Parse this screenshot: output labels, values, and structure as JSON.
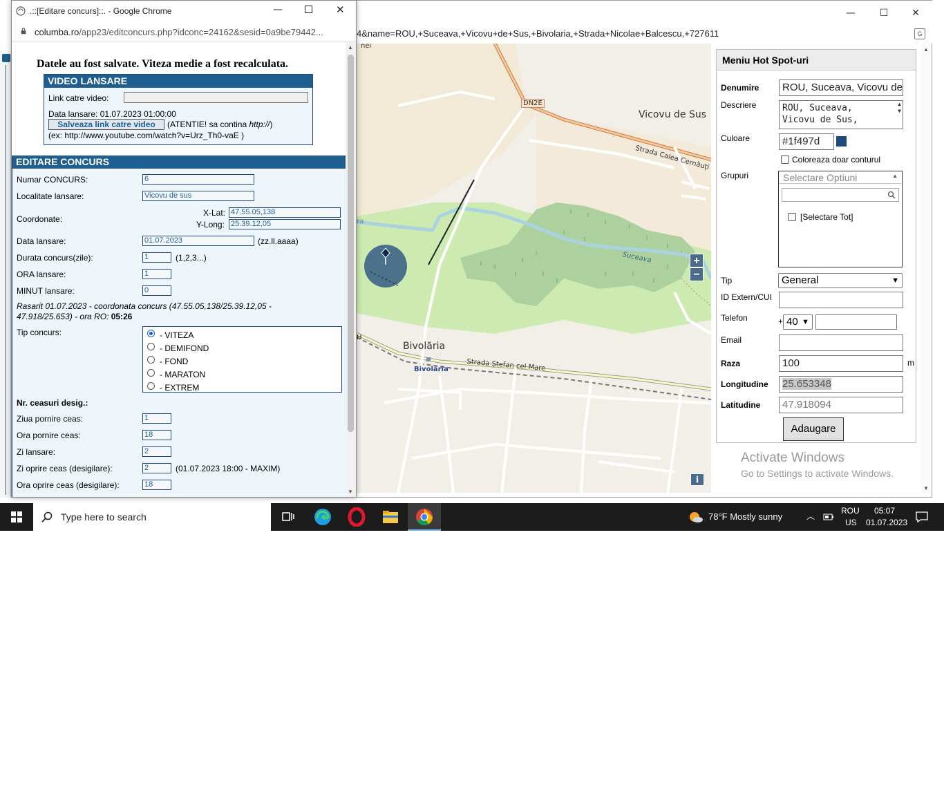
{
  "background_window": {
    "url_tail": "4&name=ROU,+Suceava,+Vicovu+de+Sus,+Bivolaria,+Strada+Nicolae+Balcescu,+727611",
    "controls": {
      "minimize": "—",
      "maximize": "☐",
      "close": "✕"
    },
    "map": {
      "labels": {
        "town1": "Vicovu de Sus",
        "road_dn2e": "DN2E",
        "street1": "Strada Calea Cernăuți",
        "river": "Suceava",
        "town2": "Bivolăria",
        "town2_small": "Bivolăria",
        "street2": "Strada Ștefan cel Mare",
        "edge1": "nei",
        "edge2": "ra",
        "edge3": "H"
      },
      "zoom_in": "+",
      "zoom_out": "−",
      "info": "i"
    },
    "hotspot_menu": {
      "title": "Meniu Hot Spot-uri",
      "denumire_label": "Denumire",
      "denumire_value": "ROU, Suceava, Vicovu de",
      "descriere_label": "Descriere",
      "descriere_value_line1": "ROU, Suceava,",
      "descriere_value_line2": "Vicovu de Sus,",
      "culoare_label": "Culoare",
      "culoare_value": "#1f497d",
      "swatch_color": "#1f497d",
      "coloreaza_label": "Coloreaza doar conturul",
      "grupuri_label": "Grupuri",
      "grupuri_placeholder": "Selectare Optiuni",
      "selectare_tot": "[Selectare Tot]",
      "tip_label": "Tip",
      "tip_value": "General",
      "id_label": "ID Extern/CUI",
      "telefon_label": "Telefon",
      "telefon_prefix": "+",
      "telefon_code": "40",
      "email_label": "Email",
      "raza_label": "Raza",
      "raza_value": "100",
      "raza_unit": "m",
      "longitudine_label": "Longitudine",
      "longitudine_value": "25.653348",
      "latitudine_label": "Latitudine",
      "latitudine_value": "47.918094",
      "add_button": "Adaugare"
    },
    "activate": {
      "line1": "Activate Windows",
      "line2": "Go to Settings to activate Windows."
    }
  },
  "popup": {
    "title": ".::[Editare concurs]::. - Google Chrome",
    "url_domain": "columba.ro",
    "url_path": "/app23/editconcurs.php?idconc=24162&sesid=0a9be79442...",
    "saved_message": "Datele au fost salvate. Viteza medie a fost recalculata.",
    "video": {
      "header": "VIDEO LANSARE",
      "link_label": "Link catre video:",
      "data_lansare": "Data lansare: 01.07.2023 01:00:00",
      "save_button": "Salveaza link catre video",
      "warning_pre": "(ATENTIE! sa contina ",
      "warning_em": "http://",
      "warning_post": ")",
      "example": "(ex: http://www.youtube.com/watch?v=Urz_Th0-vaE )"
    },
    "edit": {
      "header": "EDITARE CONCURS",
      "numar_label": "Numar CONCURS:",
      "numar_value": "6",
      "localitate_label": "Localitate lansare:",
      "localitate_value": "Vicovu de sus",
      "coordonate_label": "Coordonate:",
      "xlat_label": "X-Lat:",
      "xlat_value": "47.55.05,138",
      "ylong_label": "Y-Long:",
      "ylong_value": "25.39.12,05",
      "data_label": "Data lansare:",
      "data_value": "01.07.2023",
      "data_format": "(zz.ll.aaaa)",
      "durata_label": "Durata concurs(zile):",
      "durata_value": "1",
      "durata_note": "(1,2,3...)",
      "ora_label": "ORA lansare:",
      "ora_value": "1",
      "minut_label": "MINUT lansare:",
      "minut_value": "0",
      "rasarit_line1": "Rasarit 01.07.2023 - coordonata concurs (47.55.05,138/25.39.12,05 -",
      "rasarit_line2": "47.918/25.653) - ora RO: ",
      "rasarit_time": "05:26",
      "tip_label": "Tip concurs:",
      "tip_options": [
        "- VITEZA",
        "- DEMIFOND",
        "- FOND",
        "- MARATON",
        "- EXTREM"
      ],
      "ceasuri_label": "Nr. ceasuri desig.:",
      "ziua_pornire_label": "Ziua pornire ceas:",
      "ziua_pornire_value": "1",
      "ora_pornire_label": "Ora pornire ceas:",
      "ora_pornire_value": "18",
      "zi_lansare_label": "Zi lansare:",
      "zi_lansare_value": "2",
      "zi_oprire_label": "Zi oprire ceas (desigilare):",
      "zi_oprire_value": "2",
      "zi_oprire_note": "(01.07.2023 18:00 - MAXIM)",
      "ora_oprire_label": "Ora oprire ceas (desigilare):",
      "ora_oprire_value": "18"
    }
  },
  "taskbar": {
    "search_placeholder": "Type here to search",
    "weather": "78°F  Mostly sunny",
    "lang1": "ROU",
    "lang2": "US",
    "time": "05:07",
    "date": "01.07.2023"
  }
}
